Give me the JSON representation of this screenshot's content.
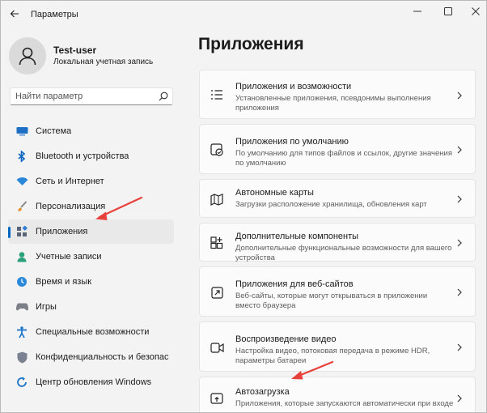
{
  "window": {
    "title": "Параметры"
  },
  "profile": {
    "name": "Test-user",
    "account_type": "Локальная учетная запись"
  },
  "search": {
    "placeholder": "Найти параметр"
  },
  "sidebar": {
    "items": [
      {
        "label": "Система",
        "icon": "monitor-icon"
      },
      {
        "label": "Bluetooth и устройства",
        "icon": "bluetooth-icon"
      },
      {
        "label": "Сеть и Интернет",
        "icon": "wifi-icon"
      },
      {
        "label": "Персонализация",
        "icon": "brush-icon"
      },
      {
        "label": "Приложения",
        "icon": "apps-icon",
        "active": true
      },
      {
        "label": "Учетные записи",
        "icon": "person-icon"
      },
      {
        "label": "Время и язык",
        "icon": "globe-clock-icon"
      },
      {
        "label": "Игры",
        "icon": "gamepad-icon"
      },
      {
        "label": "Специальные возможности",
        "icon": "accessibility-icon"
      },
      {
        "label": "Конфиденциальность и безопас",
        "icon": "shield-icon"
      },
      {
        "label": "Центр обновления Windows",
        "icon": "update-icon"
      }
    ]
  },
  "main": {
    "title": "Приложения",
    "cards": [
      {
        "title": "Приложения и возможности",
        "description": "Установленные приложения, псевдонимы выполнения приложения",
        "icon": "list-icon"
      },
      {
        "title": "Приложения по умолчанию",
        "description": "По умолчанию для типов файлов и ссылок, другие значения по умолчанию",
        "icon": "default-apps-icon"
      },
      {
        "title": "Автономные карты",
        "description": "Загрузки расположение хранилища, обновления карт",
        "icon": "map-icon"
      },
      {
        "title": "Дополнительные компоненты",
        "description": "Дополнительные функциональные возможности для вашего устройства",
        "icon": "add-components-icon"
      },
      {
        "title": "Приложения для веб-сайтов",
        "description": "Веб-сайты, которые могут открываться в приложении вместо браузера",
        "icon": "open-external-icon"
      },
      {
        "title": "Воспроизведение видео",
        "description": "Настройка видео, потоковая передача в режиме HDR, параметры батареи",
        "icon": "video-icon"
      },
      {
        "title": "Автозагрузка",
        "description": "Приложения, которые запускаются автоматически при входе",
        "icon": "startup-icon"
      }
    ]
  },
  "colors": {
    "accent": "#0067c0",
    "annotation_arrow": "#e8403a"
  }
}
